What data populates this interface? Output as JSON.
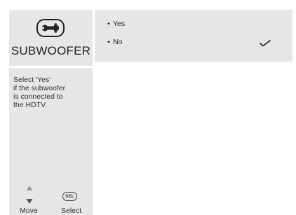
{
  "sidebar": {
    "title": "SUBWOOFER",
    "icon": "wrench-icon",
    "help_text": "Select 'Yes'\nif the subwoofer\nis connected to\nthe HDTV.",
    "hints": {
      "move_label": "Move",
      "select_label": "Select",
      "select_icon_text": "SEL"
    }
  },
  "options": {
    "items": [
      {
        "label": "Yes",
        "selected": false
      },
      {
        "label": "No",
        "selected": true
      }
    ],
    "bullet": "•"
  },
  "colors": {
    "panel_bg": "#e6e6e6",
    "page_bg": "#ffffff",
    "text": "#222222"
  }
}
